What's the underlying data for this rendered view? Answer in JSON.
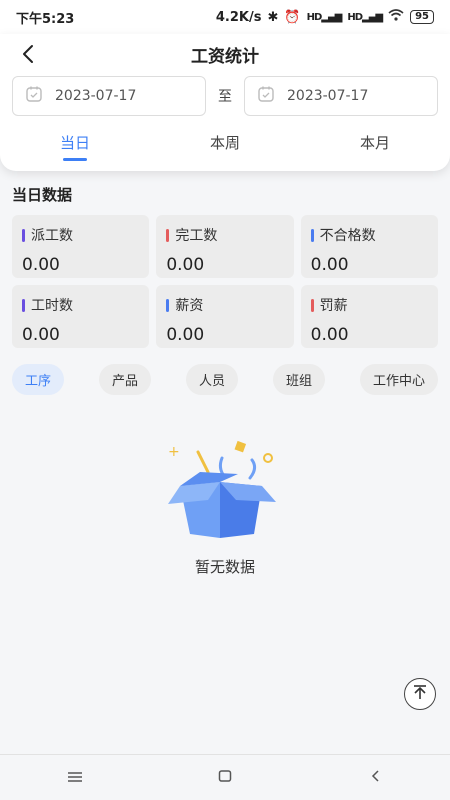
{
  "status_bar": {
    "time": "下午5:23",
    "speed": "4.2K/s",
    "signal_1": "HD",
    "signal_2": "HD",
    "battery": "95"
  },
  "nav": {
    "title": "工资统计",
    "back_icon": "arrow-left-icon"
  },
  "date_range": {
    "start": "2023-07-17",
    "separator": "至",
    "end": "2023-07-17",
    "calendar_icon": "calendar-icon"
  },
  "tabs": [
    {
      "label": "当日",
      "active": true
    },
    {
      "label": "本周",
      "active": false
    },
    {
      "label": "本月",
      "active": false
    }
  ],
  "section_title": "当日数据",
  "stats": [
    {
      "label": "派工数",
      "value": "0.00",
      "color": "#6a4fe0"
    },
    {
      "label": "完工数",
      "value": "0.00",
      "color": "#e45c5c"
    },
    {
      "label": "不合格数",
      "value": "0.00",
      "color": "#4a7cf0"
    },
    {
      "label": "工时数",
      "value": "0.00",
      "color": "#6a4fe0"
    },
    {
      "label": "薪资",
      "value": "0.00",
      "color": "#4a7cf0"
    },
    {
      "label": "罚薪",
      "value": "0.00",
      "color": "#e45c5c"
    }
  ],
  "filters": [
    {
      "label": "工序",
      "active": true
    },
    {
      "label": "产品",
      "active": false
    },
    {
      "label": "人员",
      "active": false
    },
    {
      "label": "班组",
      "active": false
    },
    {
      "label": "工作中心",
      "active": false
    }
  ],
  "empty_state": {
    "text": "暂无数据",
    "icon": "empty-box-icon"
  },
  "colors": {
    "accent": "#3d7ff5",
    "box": "#5b8ef0"
  }
}
